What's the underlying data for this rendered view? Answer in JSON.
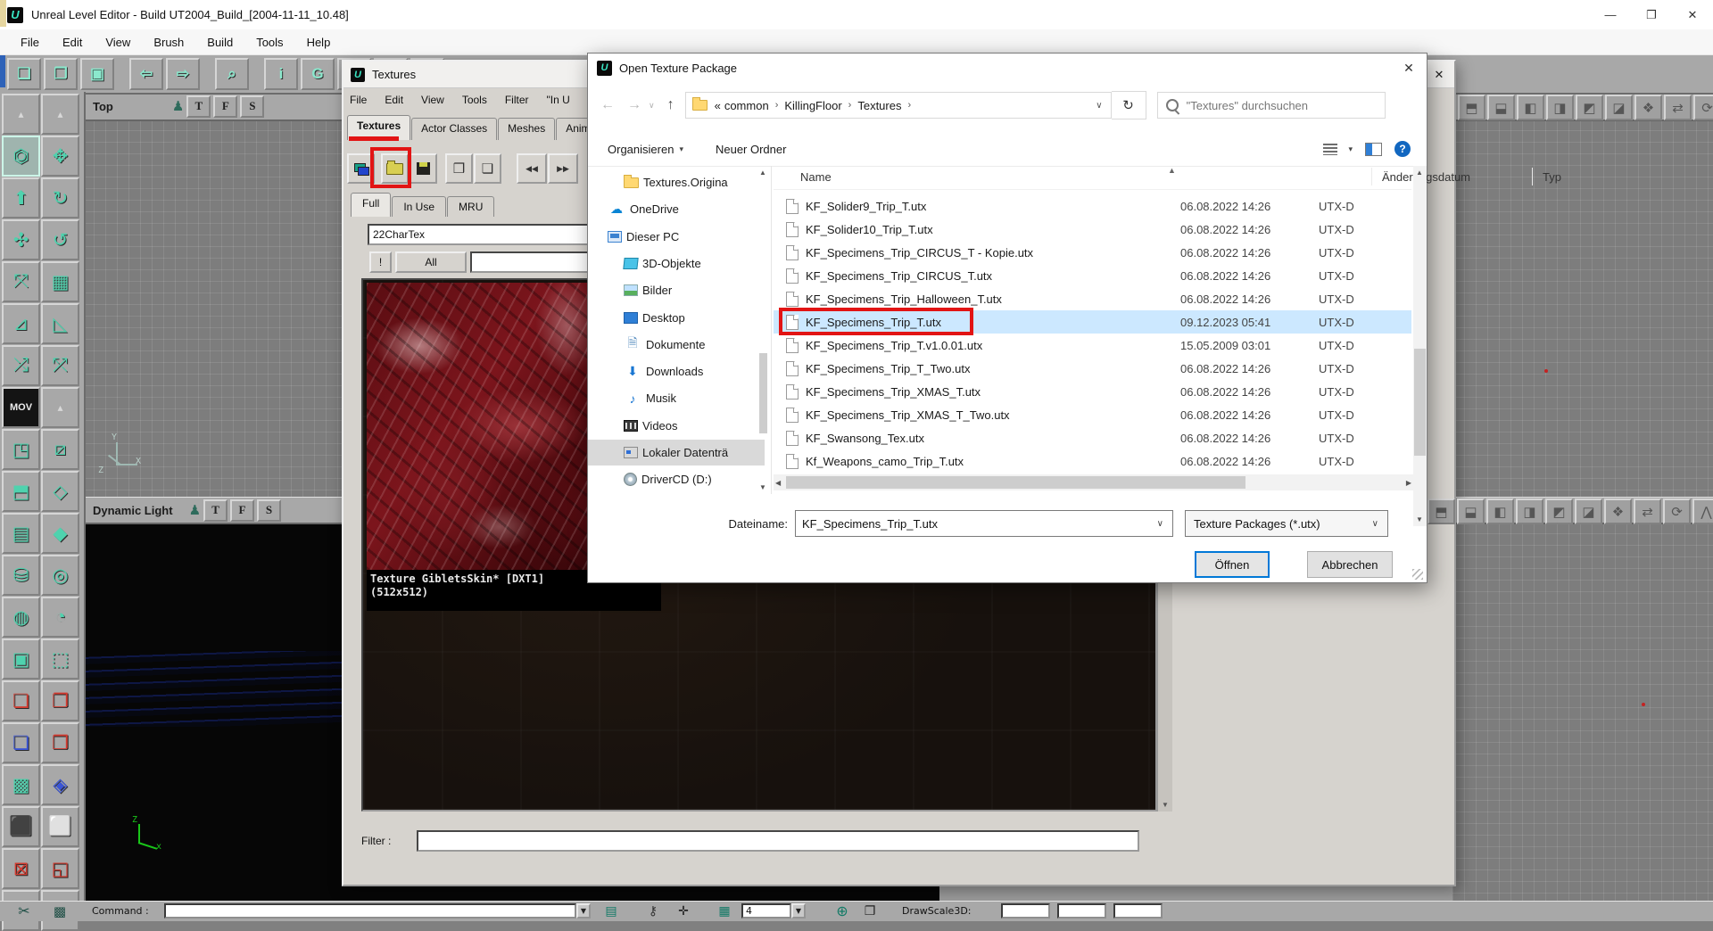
{
  "main_window": {
    "title": "Unreal Level Editor - Build UT2004_Build_[2004-11-11_10.48]",
    "menu": [
      "File",
      "Edit",
      "View",
      "Brush",
      "Build",
      "Tools",
      "Help"
    ],
    "controls": {
      "minimize": "—",
      "maximize": "❐",
      "close": "✕"
    },
    "logo_letter": "U"
  },
  "main_toolbar": {
    "groups": [
      [
        {
          "name": "new-map-icon",
          "g": "❏"
        },
        {
          "name": "open-map-icon",
          "g": "❐"
        },
        {
          "name": "save-map-icon",
          "g": "▣"
        }
      ],
      [
        {
          "name": "undo-icon",
          "g": "⇦"
        },
        {
          "name": "redo-icon",
          "g": "⇨"
        }
      ],
      [
        {
          "name": "search-actors-icon",
          "g": "⌕"
        }
      ],
      [
        {
          "name": "help-info-icon",
          "g": "i"
        },
        {
          "name": "unrealscript-icon",
          "g": "G"
        },
        {
          "name": "music-icon",
          "g": "♪"
        },
        {
          "name": "sound-icon",
          "g": "◁"
        },
        {
          "name": "image-icon",
          "g": "▦"
        }
      ]
    ]
  },
  "palette": {
    "icons": [
      {
        "g": "▴",
        "cls": "dim"
      },
      {
        "g": "▴",
        "cls": "dim"
      },
      {
        "g": "⏣",
        "cls": "sel"
      },
      {
        "g": "✥"
      },
      {
        "g": "⬆",
        "cls": ""
      },
      {
        "g": "↻"
      },
      {
        "g": "✣"
      },
      {
        "g": "↺"
      },
      {
        "g": "⤧"
      },
      {
        "g": "▦"
      },
      {
        "g": "⊿"
      },
      {
        "g": "◺"
      },
      {
        "g": "⤮"
      },
      {
        "g": "⤱"
      },
      {
        "g": "MOV",
        "cls": "mov"
      },
      {
        "g": "▴",
        "cls": "dim"
      },
      {
        "g": "◳"
      },
      {
        "g": "⧄"
      },
      {
        "g": "⬒"
      },
      {
        "g": "◇"
      },
      {
        "g": "▤"
      },
      {
        "g": "◆"
      },
      {
        "g": "⛁"
      },
      {
        "g": "◎"
      },
      {
        "g": "◍"
      },
      {
        "g": "◔"
      },
      {
        "g": "▣"
      },
      {
        "g": "⬚"
      },
      {
        "g": "❏",
        "cls": "red"
      },
      {
        "g": "❐",
        "cls": "red"
      },
      {
        "g": "❏",
        "cls": "blue"
      },
      {
        "g": "❒",
        "cls": "red"
      },
      {
        "g": "▩"
      },
      {
        "g": "◈",
        "cls": "blue"
      },
      {
        "g": "⬛",
        "cls": "blue"
      },
      {
        "g": "⬜",
        "cls": "red"
      },
      {
        "g": "⊠",
        "cls": "red"
      },
      {
        "g": "◱",
        "cls": "red"
      },
      {
        "g": "✂"
      },
      {
        "g": "▦"
      }
    ]
  },
  "viewports": {
    "top_label": "Top",
    "bottom_label": "Dynamic Light",
    "overlay_buttons": [
      "T",
      "F",
      "S"
    ],
    "actor_icon": "♟",
    "cube_toolbar": [
      "⬒",
      "⬓",
      "◧",
      "◨",
      "◩",
      "◪",
      "❖",
      "⇄",
      "⟳",
      "⋀"
    ],
    "axis_top": [
      "Y",
      "Z",
      "X"
    ],
    "axis_bottom": [
      "Z",
      "x"
    ]
  },
  "texture_browser": {
    "title": "Textures",
    "close_glyph": "✕",
    "menu": [
      "File",
      "Edit",
      "View",
      "Tools",
      "Filter",
      "\"In U"
    ],
    "tabs": [
      "Textures",
      "Actor Classes",
      "Meshes",
      "Animation"
    ],
    "active_tab": "Textures",
    "toolbar_arrows": {
      "prev": "◀◀",
      "next": "▶▶"
    },
    "subtabs": [
      "Full",
      "In Use",
      "MRU"
    ],
    "active_subtab": "Full",
    "package_value": "22CharTex",
    "bang_button": "!",
    "all_button": "All",
    "caption_line1": "Texture GibletsSkin* [DXT1]",
    "caption_line2": "(512x512)",
    "filter_label": "Filter :"
  },
  "dialog": {
    "title": "Open Texture Package",
    "close_glyph": "✕",
    "nav": {
      "back": "←",
      "forward": "→",
      "chevron": "∨",
      "up": "↑",
      "refresh": "↻"
    },
    "breadcrumb_prefix": "«",
    "breadcrumb": [
      "common",
      "KillingFloor",
      "Textures"
    ],
    "breadcrumb_sep": "›",
    "search_placeholder": "\"Textures\" durchsuchen",
    "toolbar": {
      "organize": "Organisieren",
      "new_folder": "Neuer Ordner",
      "help": "?"
    },
    "sidebar": [
      {
        "label": "Textures.Origina",
        "icon": "folder",
        "indent": 1
      },
      {
        "label": "OneDrive",
        "glyph": "☁",
        "color": "#0a84d4",
        "indent": 0
      },
      {
        "label": "Dieser PC",
        "icon": "pc",
        "indent": 0
      },
      {
        "label": "3D-Objekte",
        "icon": "objects3d",
        "indent": 1
      },
      {
        "label": "Bilder",
        "icon": "pictures",
        "indent": 1
      },
      {
        "label": "Desktop",
        "icon": "desktop",
        "indent": 1
      },
      {
        "label": "Dokumente",
        "glyph": "🗎",
        "color": "#5a8fc0",
        "indent": 1
      },
      {
        "label": "Downloads",
        "glyph": "⬇",
        "color": "#1976d2",
        "indent": 1
      },
      {
        "label": "Musik",
        "glyph": "♪",
        "color": "#1976d2",
        "indent": 1
      },
      {
        "label": "Videos",
        "icon": "videos",
        "indent": 1
      },
      {
        "label": "Lokaler Datenträ",
        "icon": "disk",
        "indent": 1,
        "selected": true
      },
      {
        "label": "DriverCD (D:)",
        "icon": "cd",
        "indent": 1
      }
    ],
    "columns": [
      "Name",
      "Änderungsdatum",
      "Typ"
    ],
    "files": [
      {
        "name": "KF_Solider9_Trip_T.utx",
        "date": "06.08.2022 14:26",
        "type": "UTX-D"
      },
      {
        "name": "KF_Solider10_Trip_T.utx",
        "date": "06.08.2022 14:26",
        "type": "UTX-D"
      },
      {
        "name": "KF_Specimens_Trip_CIRCUS_T - Kopie.utx",
        "date": "06.08.2022 14:26",
        "type": "UTX-D"
      },
      {
        "name": "KF_Specimens_Trip_CIRCUS_T.utx",
        "date": "06.08.2022 14:26",
        "type": "UTX-D"
      },
      {
        "name": "KF_Specimens_Trip_Halloween_T.utx",
        "date": "06.08.2022 14:26",
        "type": "UTX-D"
      },
      {
        "name": "KF_Specimens_Trip_T.utx",
        "date": "09.12.2023 05:41",
        "type": "UTX-D",
        "selected": true,
        "annotated": true
      },
      {
        "name": "KF_Specimens_Trip_T.v1.0.01.utx",
        "date": "15.05.2009 03:01",
        "type": "UTX-D"
      },
      {
        "name": "KF_Specimens_Trip_T_Two.utx",
        "date": "06.08.2022 14:26",
        "type": "UTX-D"
      },
      {
        "name": "KF_Specimens_Trip_XMAS_T.utx",
        "date": "06.08.2022 14:26",
        "type": "UTX-D"
      },
      {
        "name": "KF_Specimens_Trip_XMAS_T_Two.utx",
        "date": "06.08.2022 14:26",
        "type": "UTX-D"
      },
      {
        "name": "KF_Swansong_Tex.utx",
        "date": "06.08.2022 14:26",
        "type": "UTX-D"
      },
      {
        "name": "Kf_Weapons_camo_Trip_T.utx",
        "date": "06.08.2022 14:26",
        "type": "UTX-D"
      }
    ],
    "filename_label": "Dateiname:",
    "filename_value": "KF_Specimens_Trip_T.utx",
    "filetype_value": "Texture Packages (*.utx)",
    "open_button": "Öffnen",
    "cancel_button": "Abbrechen"
  },
  "statusbar": {
    "scissors_icon": "✂",
    "marquee_icon": "▩",
    "command_label": "Command :",
    "list_icon": "▤",
    "lock_icon": "⚷",
    "crosshair_icon": "✛",
    "grid_icon": "▦",
    "grid_value": "4",
    "globe_icon": "⊕",
    "copy_icon": "❐",
    "drawscale_label": "DrawScale3D:"
  },
  "colors": {
    "annotation": "#e21414",
    "selection_blue": "#cce8ff",
    "accent_blue": "#0078d7",
    "editor_teal": "#4fd2ae"
  }
}
